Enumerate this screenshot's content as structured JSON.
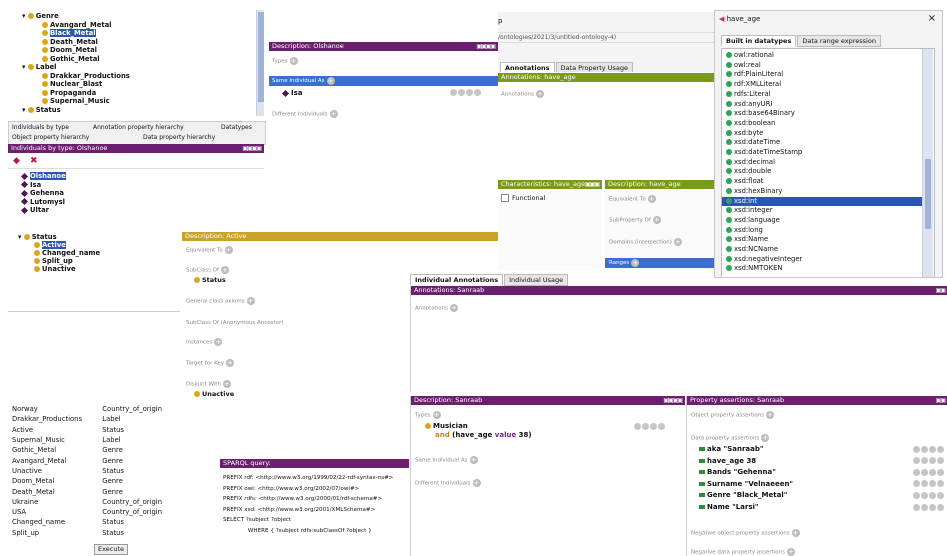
{
  "colors": {
    "purple": "#6b1f6e",
    "olive": "#7a9a1e",
    "gold": "#c9a227",
    "selection": "#2a55b0",
    "class_dot": "#d8a81a",
    "datatype_dot": "#2aa55a"
  },
  "class_tree": {
    "genre": "Genre",
    "genre_children": [
      "Avangard_Metal",
      "Black_Metal",
      "Death_Metal",
      "Doom_Metal",
      "Gothic_Metal"
    ],
    "label": "Label",
    "label_children": [
      "Drakkar_Productions",
      "Nuclear_Blast",
      "Propaganda",
      "Supernal_Music"
    ],
    "status": "Status"
  },
  "hierarchy_tabs": [
    "Individuals by type",
    "Annotation property hierarchy",
    "Datatypes",
    "Object property hierarchy",
    "Data property hierarchy"
  ],
  "individuals_panel": {
    "header": "Individuals by type: Olshanoe",
    "items": [
      "Olshanoe",
      "Isa",
      "Gehenna",
      "Lutomysl",
      "Ultar"
    ]
  },
  "desc_olshanoe": {
    "header": "Description: Olshanoe",
    "types": "Types",
    "same_individual": "Same Individual As",
    "same_value": "Isa",
    "different": "Different Individuals"
  },
  "top_right": {
    "url_fragment": "p",
    "path": "/ontologies/2021/3/untitled-ontology-4)",
    "tabs": [
      "Annotations",
      "Data Property Usage"
    ],
    "ann_header": "Annotations: have_age",
    "annotations": "Annotations"
  },
  "characteristics": {
    "header": "Characteristics: have_age",
    "functional": "Functional"
  },
  "desc_have_age": {
    "header": "Description: have_age",
    "equivalent": "Equivalent To",
    "subproperty": "SubProperty Of",
    "domains": "Domains (intersection)",
    "ranges": "Ranges"
  },
  "datatype_dialog": {
    "title": "have_age",
    "tabs": [
      "Built in datatypes",
      "Data range expression"
    ],
    "items": [
      "owl:rational",
      "owl:real",
      "rdf:PlainLiteral",
      "rdf:XMLLiteral",
      "rdfs:Literal",
      "xsd:anyURI",
      "xsd:base64Binary",
      "xsd:boolean",
      "xsd:byte",
      "xsd:dateTime",
      "xsd:dateTimeStamp",
      "xsd:decimal",
      "xsd:double",
      "xsd:float",
      "xsd:hexBinary",
      "xsd:int",
      "xsd:integer",
      "xsd:language",
      "xsd:long",
      "xsd:Name",
      "xsd:NCName",
      "xsd:negativeInteger",
      "xsd:NMTOKEN"
    ],
    "selected": "xsd:int",
    "close": "×"
  },
  "status_tree": {
    "root": "Status",
    "children": [
      "Active",
      "Changed_name",
      "Split_up",
      "Unactive"
    ],
    "selected": "Active"
  },
  "desc_active": {
    "header": "Description: Active",
    "equivalent": "Equivalent To",
    "subclass": "SubClass Of",
    "subclass_value": "Status",
    "general": "General class axioms",
    "anon": "SubClass Of (Anonymous Ancestor)",
    "instances": "Instances",
    "target": "Target for Key",
    "disjoint": "Disjoint With",
    "disjoint_value": "Unactive"
  },
  "individual_tabs": [
    "Individual Annotations",
    "Individual Usage"
  ],
  "ann_sanraab": {
    "header": "Annotations: Sanraab",
    "annotations": "Annotations"
  },
  "desc_sanraab": {
    "header": "Description: Sanraab",
    "types": "Types",
    "type_value": "Musician",
    "type_and": "and",
    "type_expr_open": "(have_age",
    "type_value_kw": "value",
    "type_expr_close": "38)",
    "same": "Same Individual As",
    "different": "Different Individuals"
  },
  "prop_assertions": {
    "header": "Property assertions: Sanraab",
    "object": "Object property assertions",
    "data": "Data property assertions",
    "items": [
      {
        "prop": "aka",
        "val": "\"Sanraab\""
      },
      {
        "prop": "have_age",
        "val": "38"
      },
      {
        "prop": "Bands",
        "val": "\"Gehenna\""
      },
      {
        "prop": "Surname",
        "val": "\"Velnaeeen\""
      },
      {
        "prop": "Genre",
        "val": "\"Black_Metal\""
      },
      {
        "prop": "Name",
        "val": "\"Larsi\""
      }
    ],
    "neg_object": "Negative object property assertions",
    "neg_data": "Negative data property assertions"
  },
  "results": {
    "rows": [
      [
        "Norway",
        "Country_of_origin"
      ],
      [
        "Drakkar_Productions",
        "Label"
      ],
      [
        "Active",
        "Status"
      ],
      [
        "Supernal_Music",
        "Label"
      ],
      [
        "Gothic_Metal",
        "Genre"
      ],
      [
        "Avangard_Metal",
        "Genre"
      ],
      [
        "Unactive",
        "Status"
      ],
      [
        "Doom_Metal",
        "Genre"
      ],
      [
        "Death_Metal",
        "Genre"
      ],
      [
        "Ukraine",
        "Country_of_origin"
      ],
      [
        "USA",
        "Country_of_origin"
      ],
      [
        "Changed_name",
        "Status"
      ],
      [
        "Split_up",
        "Status"
      ]
    ],
    "execute": "Execute"
  },
  "sparql": {
    "header": "SPARQL query:",
    "lines": [
      "PREFIX rdf: <http://www.w3.org/1999/02/22-rdf-syntax-ns#>",
      "PREFIX owl: <http://www.w3.org/2002/07/owl#>",
      "PREFIX rdfs: <http://www.w3.org/2000/01/rdf-schema#>",
      "PREFIX xsd: <http://www.w3.org/2001/XMLSchema#>",
      "SELECT ?subject ?object",
      "              WHERE { ?subject rdfs:subClassOf ?object }"
    ]
  }
}
